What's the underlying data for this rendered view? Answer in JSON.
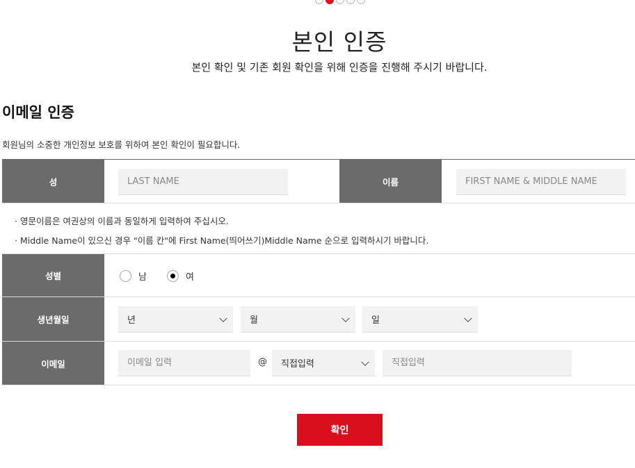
{
  "header": {
    "steps": [
      {
        "state": "done"
      },
      {
        "state": "active"
      },
      {
        "state": "todo"
      },
      {
        "state": "todo"
      },
      {
        "state": "todo"
      }
    ],
    "title": "본인 인증",
    "subtitle": "본인 확인 및 기존 회원 확인을 위해 인증을 진행해 주시기 바랍니다."
  },
  "section": {
    "title": "이메일 인증",
    "description": "회원님의 소중한 개인정보 보호를 위하여 본인 확인이 필요합니다."
  },
  "form": {
    "surname": {
      "label": "성",
      "placeholder": "LAST NAME",
      "value": ""
    },
    "given_name": {
      "label": "이름",
      "placeholder": "FIRST NAME & MIDDLE NAME",
      "value": ""
    },
    "notes": [
      "· 영문이름은 여권상의 이름과 동일하게 입력하여 주십시오.",
      "· Middle Name이 있으신 경우 \"이름 칸\"에 First Name(띄어쓰기)Middle Name 순으로 입력하시기 바랍니다."
    ],
    "gender": {
      "label": "성별",
      "options": [
        {
          "label": "남",
          "checked": false
        },
        {
          "label": "여",
          "checked": true
        }
      ]
    },
    "birthdate": {
      "label": "생년월일",
      "year": "년",
      "month": "월",
      "day": "일"
    },
    "email": {
      "label": "이메일",
      "local_placeholder": "이메일 입력",
      "at": "@",
      "domain_select": "직접입력",
      "domain_placeholder": "직접입력"
    }
  },
  "actions": {
    "confirm_label": "확인"
  },
  "colors": {
    "accent": "#da0f1e",
    "label_bg": "#6b6b6b",
    "input_bg": "#f2f2f2"
  }
}
